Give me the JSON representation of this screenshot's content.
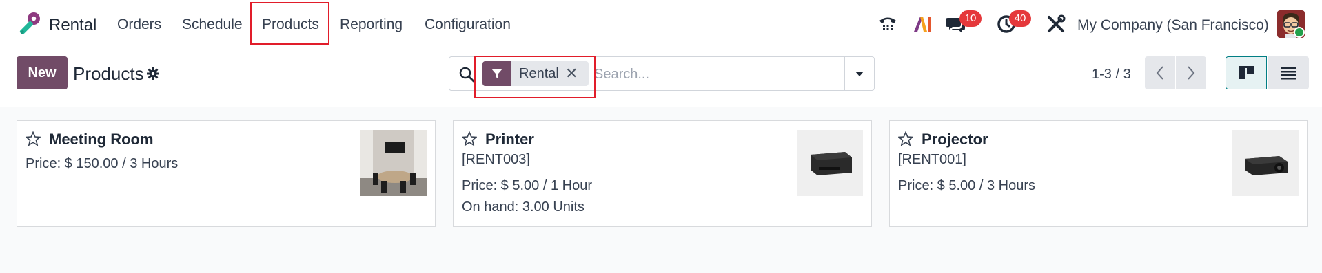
{
  "app": {
    "name": "Rental",
    "menu": [
      "Orders",
      "Schedule",
      "Products",
      "Reporting",
      "Configuration"
    ]
  },
  "systray": {
    "messages_count": "10",
    "activities_count": "40",
    "company": "My Company (San Francisco)"
  },
  "control": {
    "new_label": "New",
    "title": "Products",
    "facet_label": "Rental",
    "facet_remove": "✕",
    "search_placeholder": "Search...",
    "pager": "1-3 / 3"
  },
  "products": [
    {
      "name": "Meeting Room",
      "ref": "",
      "price": "Price: $ 150.00 / 3 Hours",
      "onhand": ""
    },
    {
      "name": "Printer",
      "ref": "[RENT003]",
      "price": "Price: $ 5.00 / 1 Hour",
      "onhand": "On hand: 3.00 Units"
    },
    {
      "name": "Projector",
      "ref": "[RENT001]",
      "price": "Price: $ 5.00 / 3 Hours",
      "onhand": ""
    }
  ],
  "colors": {
    "brand": "#714b67",
    "badge": "#e5383b",
    "highlight": "#e11d2a"
  }
}
